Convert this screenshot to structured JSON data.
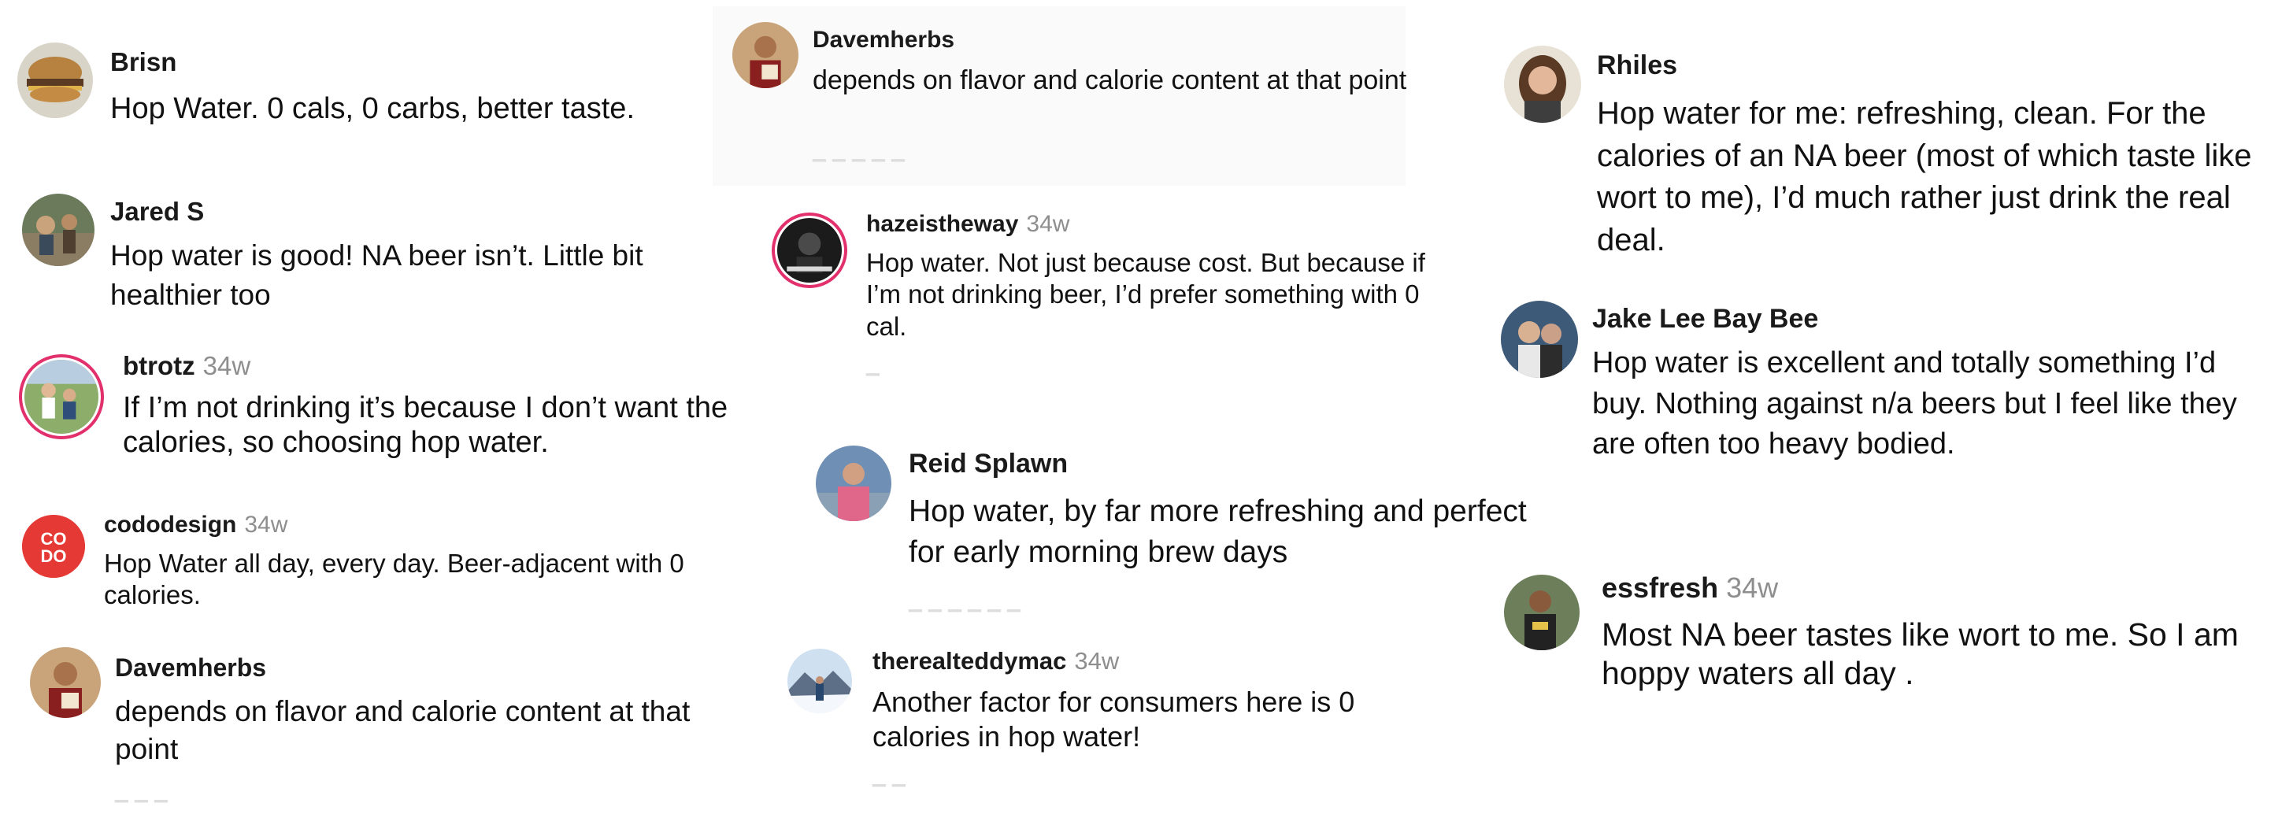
{
  "comments": [
    {
      "id": "brisn",
      "username": "Brisn",
      "age": "",
      "text": "Hop Water. 0 cals, 0 carbs, better taste.",
      "avatar_icon": "burger-photo-avatar"
    },
    {
      "id": "jared",
      "username": "Jared S",
      "age": "",
      "text": "Hop water is good! NA beer isn’t. Little bit healthier too",
      "avatar_icon": "outdoor-photo-avatar"
    },
    {
      "id": "btrotz",
      "username": "btrotz",
      "age": "34w",
      "text": "If I’m not drinking it’s because I don’t want the calories, so choosing hop water.",
      "avatar_icon": "family-photo-avatar"
    },
    {
      "id": "cododesign",
      "username": "cododesign",
      "age": "34w",
      "text": "Hop Water all day, every day. Beer-adjacent with 0 calories.",
      "avatar_icon": "codo-logo-avatar",
      "avatar_label": "CODO"
    },
    {
      "id": "dave2",
      "username": "Davemherbs",
      "age": "",
      "text": "depends on flavor and calorie content at that point",
      "avatar_icon": "person-photo-avatar"
    },
    {
      "id": "dave1",
      "username": "Davemherbs",
      "age": "",
      "text": "depends on flavor and calorie content at that point",
      "avatar_icon": "person-photo-avatar"
    },
    {
      "id": "hazeistheway",
      "username": "hazeistheway",
      "age": "34w",
      "text": "Hop water. Not just because cost. But because if I’m not drinking beer, I’d prefer something with 0 cal.",
      "avatar_icon": "brand-logo-avatar"
    },
    {
      "id": "reid",
      "username": "Reid Splawn",
      "age": "",
      "text": "Hop water, by far more refreshing and perfect for early morning brew days",
      "avatar_icon": "person-photo-avatar"
    },
    {
      "id": "teddy",
      "username": "therealteddymac",
      "age": "34w",
      "text": "Another factor for consumers here is 0 calories in hop water!",
      "avatar_icon": "snow-photo-avatar"
    },
    {
      "id": "rhiles",
      "username": "Rhiles",
      "age": "",
      "text": "Hop water for me: refreshing, clean. For the calories of an NA beer (most of which taste like wort to me), I’d much rather just drink the real deal.",
      "avatar_icon": "portrait-photo-avatar"
    },
    {
      "id": "jake",
      "username": "Jake Lee Bay Bee",
      "age": "",
      "text": "Hop water is excellent and totally something I’d buy. Nothing against n/a beers but I feel like they are often too heavy bodied.",
      "avatar_icon": "couple-photo-avatar"
    },
    {
      "id": "essfresh",
      "username": "essfresh",
      "age": "34w",
      "text": "Most NA beer tastes like wort to me. So I am hoppy waters all day .",
      "avatar_icon": "person-photo-avatar"
    }
  ],
  "colors": {
    "username": "#1a1a1a",
    "timestamp": "#8e8e8e",
    "story_ring": "#e1306c",
    "codo_red": "#e53935"
  }
}
